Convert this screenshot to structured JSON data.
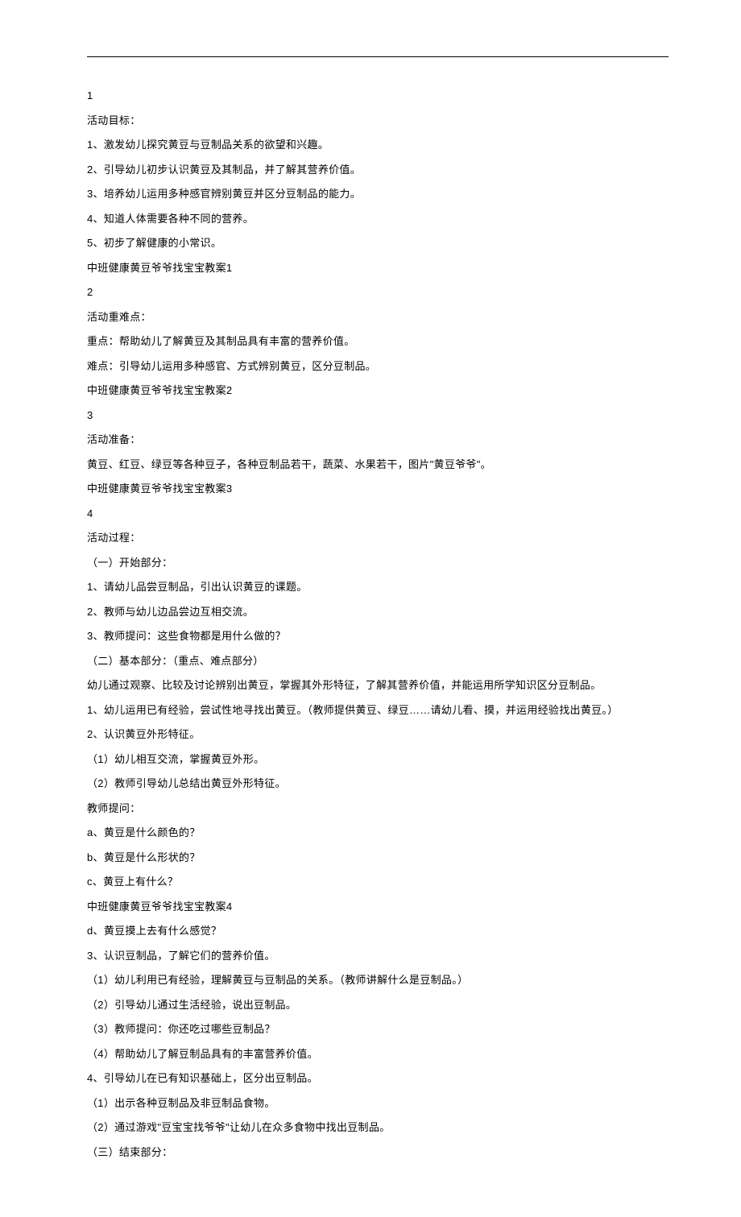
{
  "lines": [
    "1",
    "活动目标：",
    "1、激发幼儿探究黄豆与豆制品关系的欲望和兴趣。",
    "2、引导幼儿初步认识黄豆及其制品，并了解其营养价值。",
    "3、培养幼儿运用多种感官辨别黄豆并区分豆制品的能力。",
    "4、知道人体需要各种不同的营养。",
    "5、初步了解健康的小常识。",
    "中班健康黄豆爷爷找宝宝教案1",
    "2",
    "活动重难点：",
    "重点：帮助幼儿了解黄豆及其制品具有丰富的营养价值。",
    "难点：引导幼儿运用多种感官、方式辨别黄豆，区分豆制品。",
    "中班健康黄豆爷爷找宝宝教案2",
    "3",
    "活动准备：",
    "黄豆、红豆、绿豆等各种豆子，各种豆制品若干，蔬菜、水果若干，图片\"黄豆爷爷\"。",
    "中班健康黄豆爷爷找宝宝教案3",
    "4",
    "活动过程：",
    "（一）开始部分：",
    "1、请幼儿品尝豆制品，引出认识黄豆的课题。",
    "2、教师与幼儿边品尝边互相交流。",
    "3、教师提问：这些食物都是用什么做的？",
    "（二）基本部分：（重点、难点部分）",
    "幼儿通过观察、比较及讨论辨别出黄豆，掌握其外形特征，了解其营养价值，并能运用所学知识区分豆制品。",
    "1、幼儿运用已有经验，尝试性地寻找出黄豆。（教师提供黄豆、绿豆……请幼儿看、摸，并运用经验找出黄豆。）",
    "2、认识黄豆外形特征。",
    "（1）幼儿相互交流，掌握黄豆外形。",
    "（2）教师引导幼儿总结出黄豆外形特征。",
    "教师提问：",
    "a、黄豆是什么颜色的？",
    "b、黄豆是什么形状的？",
    "c、黄豆上有什么？",
    "中班健康黄豆爷爷找宝宝教案4",
    "d、黄豆摸上去有什么感觉？",
    "3、认识豆制品，了解它们的营养价值。",
    "（1）幼儿利用已有经验，理解黄豆与豆制品的关系。（教师讲解什么是豆制品。）",
    "（2）引导幼儿通过生活经验，说出豆制品。",
    "（3）教师提问：你还吃过哪些豆制品？",
    "（4）帮助幼儿了解豆制品具有的丰富营养价值。",
    "4、引导幼儿在已有知识基础上，区分出豆制品。",
    "（1）出示各种豆制品及非豆制品食物。",
    "（2）通过游戏\"豆宝宝找爷爷\"让幼儿在众多食物中找出豆制品。",
    "（三）结束部分："
  ]
}
